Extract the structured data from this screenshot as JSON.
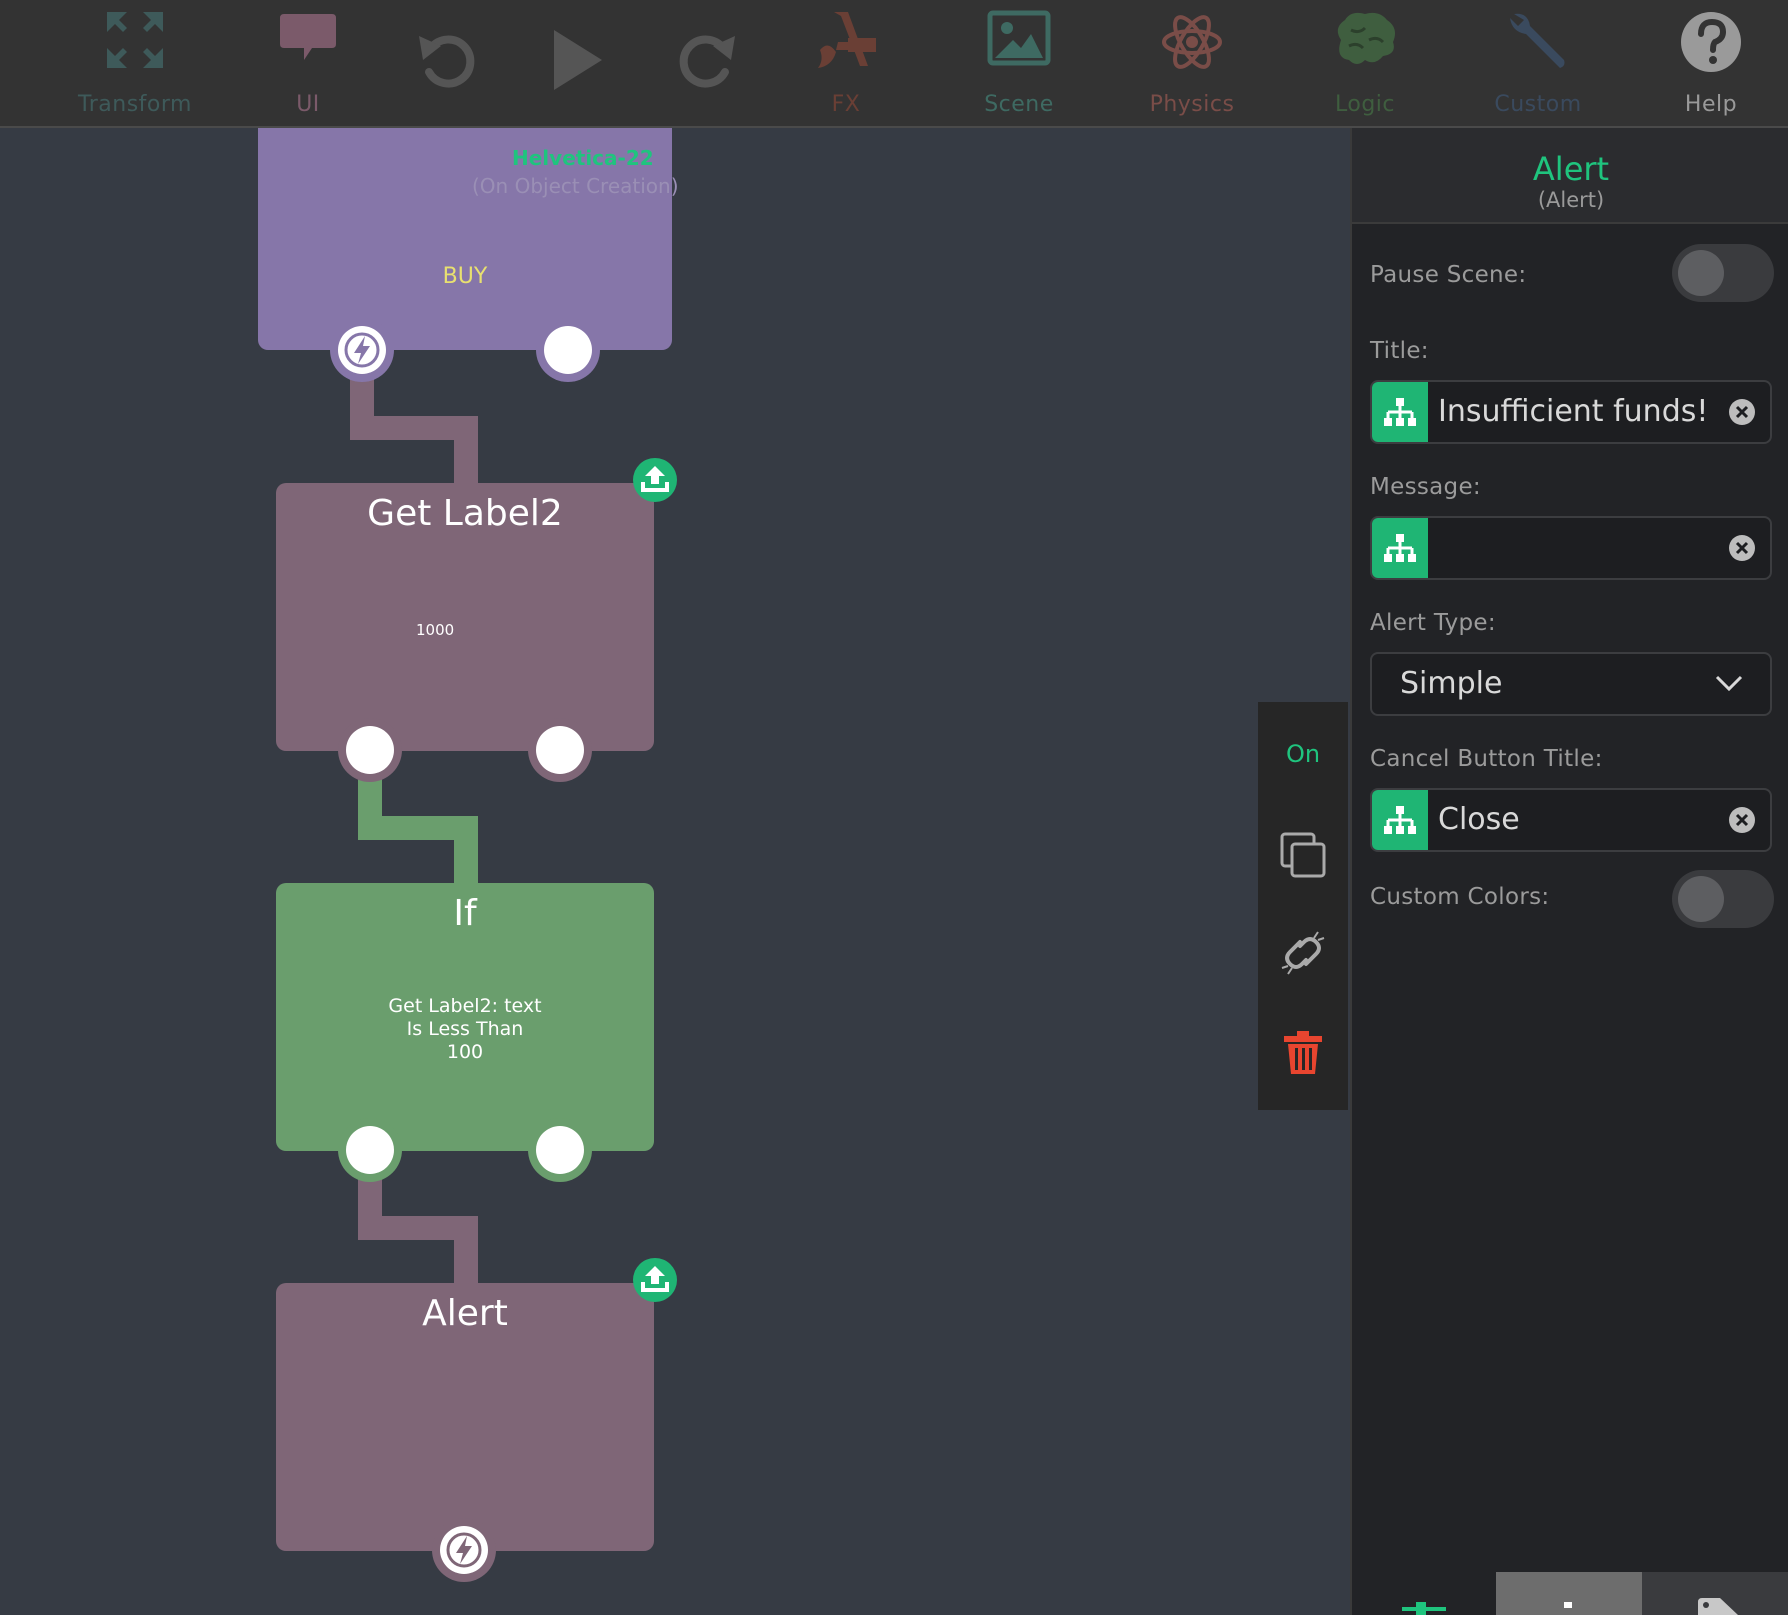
{
  "toolbar": {
    "items": [
      {
        "label": "Transform",
        "icon": "expand-arrows-icon",
        "color": "#3e5a5a"
      },
      {
        "label": "UI",
        "icon": "speech-bubble-icon",
        "color": "#7b5a6a"
      },
      {
        "label": "FX",
        "icon": "fx-brush-icon",
        "color": "#6a3f35"
      },
      {
        "label": "Scene",
        "icon": "image-icon",
        "color": "#3e6a62"
      },
      {
        "label": "Physics",
        "icon": "atom-icon",
        "color": "#7a4d48"
      },
      {
        "label": "Logic",
        "icon": "brain-icon",
        "color": "#3f5e3f"
      },
      {
        "label": "Custom",
        "icon": "wrench-icon",
        "color": "#3a4a5e"
      },
      {
        "label": "Help",
        "icon": "question-icon",
        "color": "#9a9a9a"
      }
    ],
    "undo_icon": "undo-icon",
    "play_icon": "play-icon",
    "redo_icon": "redo-icon"
  },
  "nodes": {
    "label_node": {
      "font": "Helvetica-22",
      "trigger": "(On Object Creation)",
      "text": "BUY"
    },
    "get_label": {
      "title": "Get Label2",
      "value": "1000"
    },
    "if_node": {
      "title": "If",
      "line1": "Get Label2: text",
      "line2": "Is Less Than",
      "line3": "100"
    },
    "alert": {
      "title": "Alert"
    }
  },
  "actionbar": {
    "on_label": "On"
  },
  "panel": {
    "title": "Alert",
    "subtitle": "(Alert)",
    "pause_scene_label": "Pause Scene:",
    "title_label": "Title:",
    "title_value": "Insufficient funds!",
    "message_label": "Message:",
    "message_value": "",
    "alert_type_label": "Alert Type:",
    "alert_type_value": "Simple",
    "cancel_label": "Cancel Button Title:",
    "cancel_value": "Close",
    "custom_colors_label": "Custom Colors:"
  },
  "colors": {
    "accent": "#1fc47e",
    "purple_node": "#8676a9",
    "mauve_node": "#7f6677",
    "green_node": "#6a9e6d",
    "delete": "#e8452f"
  }
}
